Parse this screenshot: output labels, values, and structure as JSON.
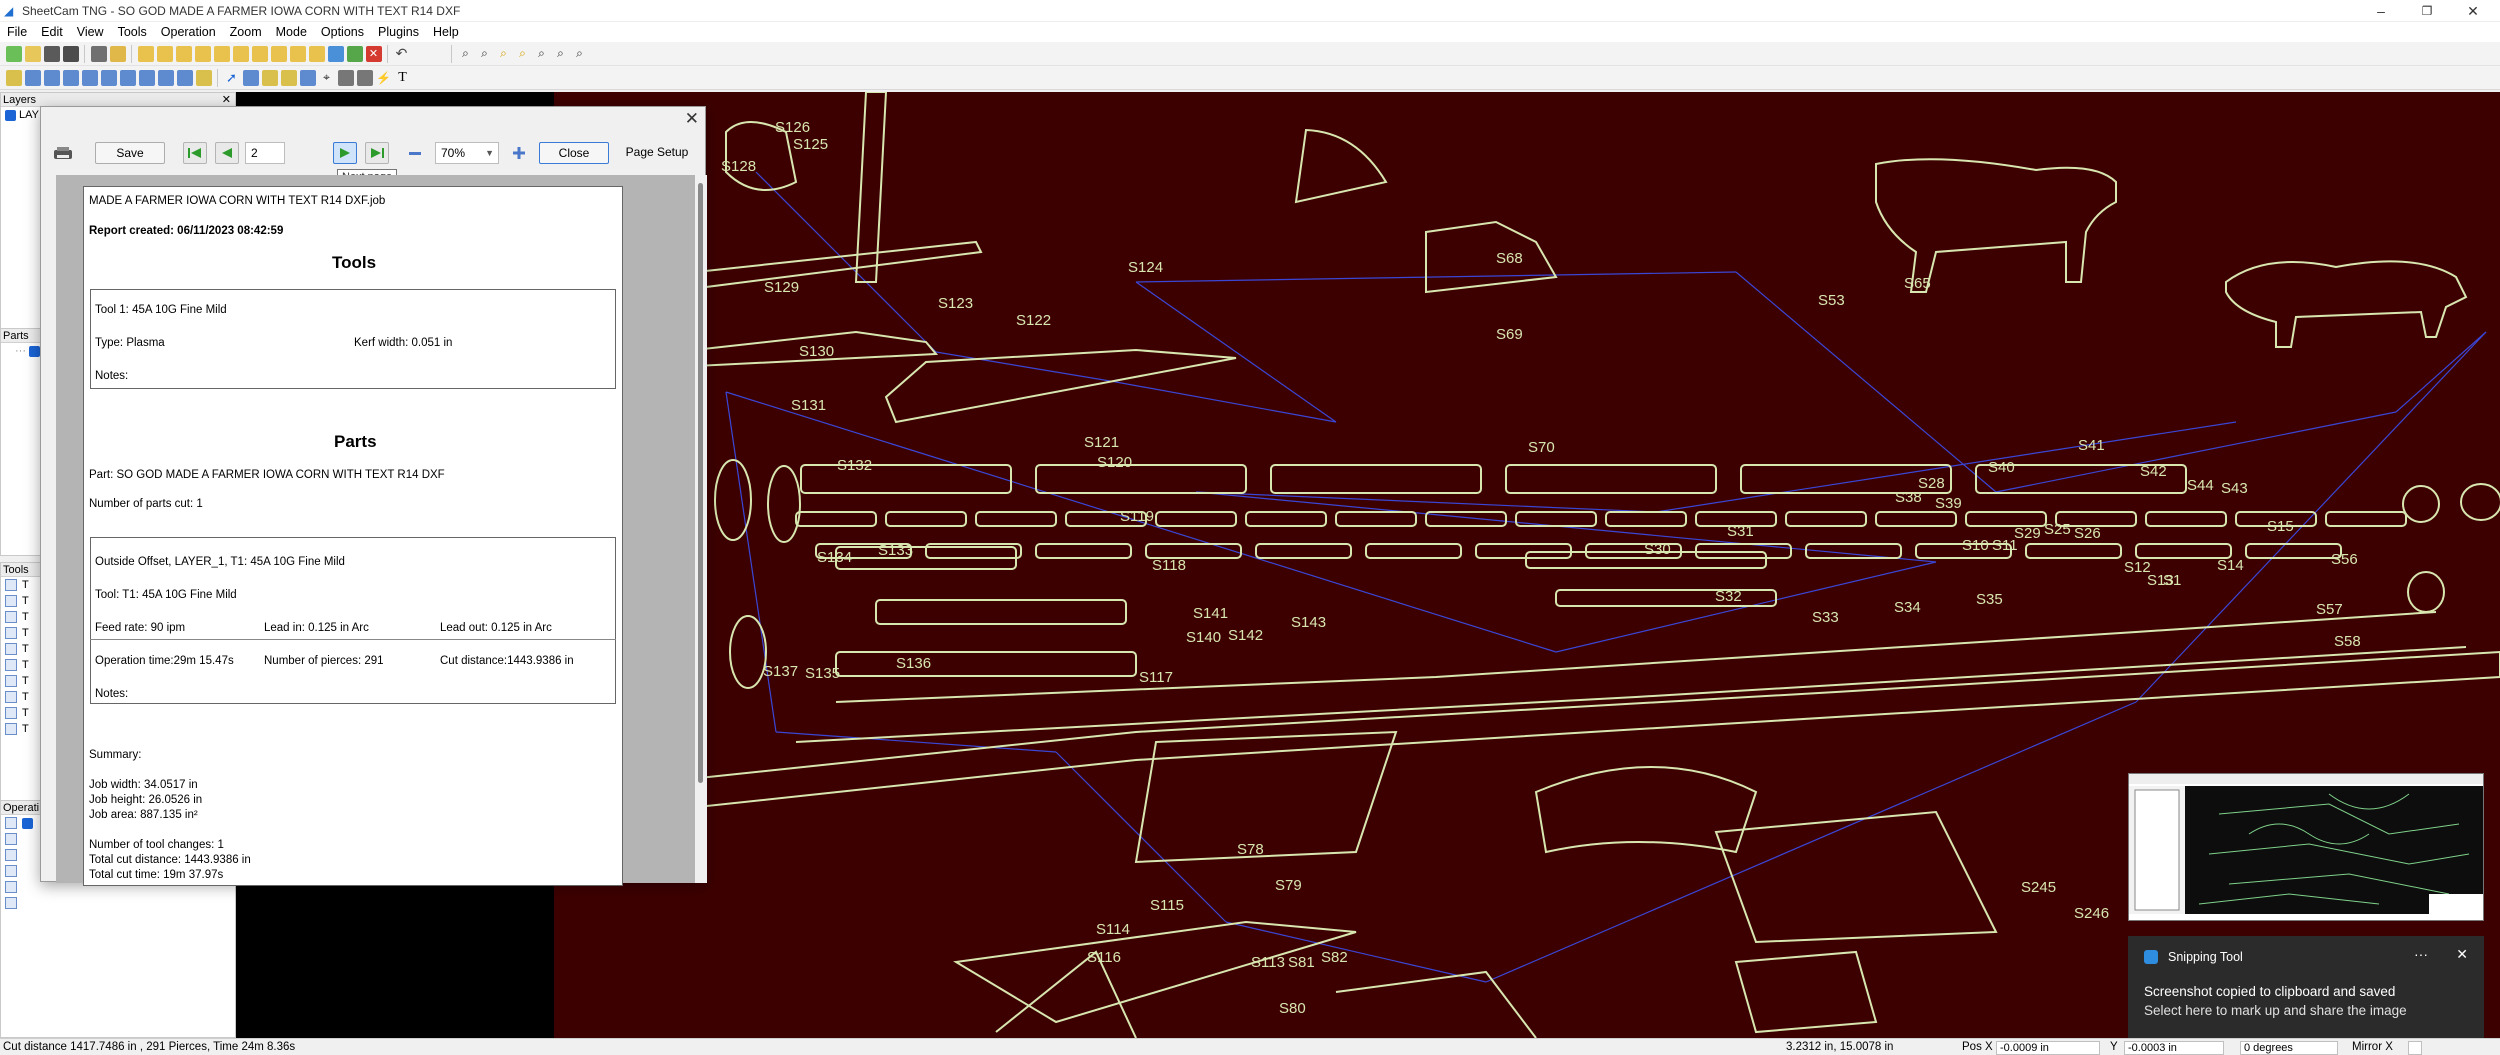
{
  "window": {
    "title": "SheetCam TNG - SO GOD MADE A FARMER IOWA CORN WITH TEXT R14 DXF",
    "controls": [
      "–",
      "❐",
      "✕"
    ]
  },
  "menu": [
    "File",
    "Edit",
    "View",
    "Tools",
    "Operation",
    "Zoom",
    "Mode",
    "Options",
    "Plugins",
    "Help"
  ],
  "panels": {
    "layers": {
      "title": "Layers",
      "close": "✕",
      "item": "LAY"
    },
    "parts": {
      "title": "Parts"
    },
    "tools": {
      "title": "Tools",
      "item_prefix": "T"
    },
    "operations": {
      "title": "Operati"
    }
  },
  "dialog": {
    "close": "✕",
    "save_label": "Save",
    "page_value": "2",
    "zoom_value": "70%",
    "close_label": "Close",
    "page_setup_label": "Page Setup",
    "tooltip": "Next page"
  },
  "report": {
    "job_title": "MADE A FARMER IOWA CORN WITH TEXT R14 DXF.job",
    "created": "Report created: 06/11/2023 08:42:59",
    "tools_heading": "Tools",
    "tool1": "Tool 1: 45A 10G Fine Mild",
    "tool_type": "Type: Plasma",
    "kerf": "Kerf width: 0.051 in",
    "tool_notes": "Notes:",
    "parts_heading": "Parts",
    "part": "Part: SO GOD MADE A FARMER IOWA CORN WITH TEXT R14 DXF",
    "parts_cut": "Number of parts cut: 1",
    "op_title": "Outside Offset, LAYER_1, T1: 45A 10G Fine Mild",
    "op_tool": "Tool: T1: 45A 10G Fine Mild",
    "feed": "Feed rate: 90 ipm",
    "lead_in": "Lead in: 0.125 in Arc",
    "lead_out": "Lead out: 0.125 in Arc",
    "op_time": "Operation time:29m 15.47s",
    "pierces": "Number of pierces: 291",
    "cut_dist": "Cut distance:1443.9386 in",
    "op_notes": "Notes:",
    "summary": "Summary:",
    "job_width": "Job width: 34.0517 in",
    "job_height": "Job height: 26.0526 in",
    "job_area": "Job area: 887.135 in²",
    "tool_changes": "Number of tool changes: 1",
    "total_cut": "Total cut distance: 1443.9386 in",
    "total_time": "Total cut time: 19m 37.97s"
  },
  "canvas_labels": [
    "S128",
    "S126",
    "S125",
    "S124",
    "S123",
    "S122",
    "S129",
    "S130",
    "S131",
    "S132",
    "S134",
    "S133",
    "S121",
    "S120",
    "S119",
    "S118",
    "S137",
    "S135",
    "S136",
    "S117",
    "S116",
    "S115",
    "S114",
    "S113",
    "S68",
    "S69",
    "S70",
    "S53",
    "S65",
    "S41",
    "S42",
    "S43",
    "S44",
    "S40",
    "S39",
    "S38",
    "S28",
    "S29",
    "S26",
    "S25",
    "S10",
    "S11",
    "S12",
    "S13",
    "S14",
    "S15",
    "S30",
    "S31",
    "S32",
    "S33",
    "S34",
    "S35",
    "S1",
    "S56",
    "S57",
    "S58",
    "S78",
    "S79",
    "S80",
    "S81",
    "S82",
    "S245",
    "S246",
    "S140",
    "S141",
    "S142",
    "S143"
  ],
  "status": {
    "left": "Cut distance 1417.7486 in , 291 Pierces, Time 24m 8.36s",
    "coords": "3.2312 in, 15.0078 in",
    "posx_label": "Pos X",
    "posx_value": "-0.0009 in",
    "y_label": "Y",
    "y_value": "-0.0003 in",
    "angle": "0 degrees",
    "mirror": "Mirror X"
  },
  "toast": {
    "app": "Snipping Tool",
    "more": "···",
    "close": "✕",
    "message": "Screenshot copied to clipboard and saved",
    "sub": "Select here to mark up and share the image"
  },
  "colors": {
    "canvas_bg": "#3d0000",
    "part_outline": "#d8e6b0",
    "rapid": "#3a46d6",
    "accent": "#1a64d6"
  }
}
